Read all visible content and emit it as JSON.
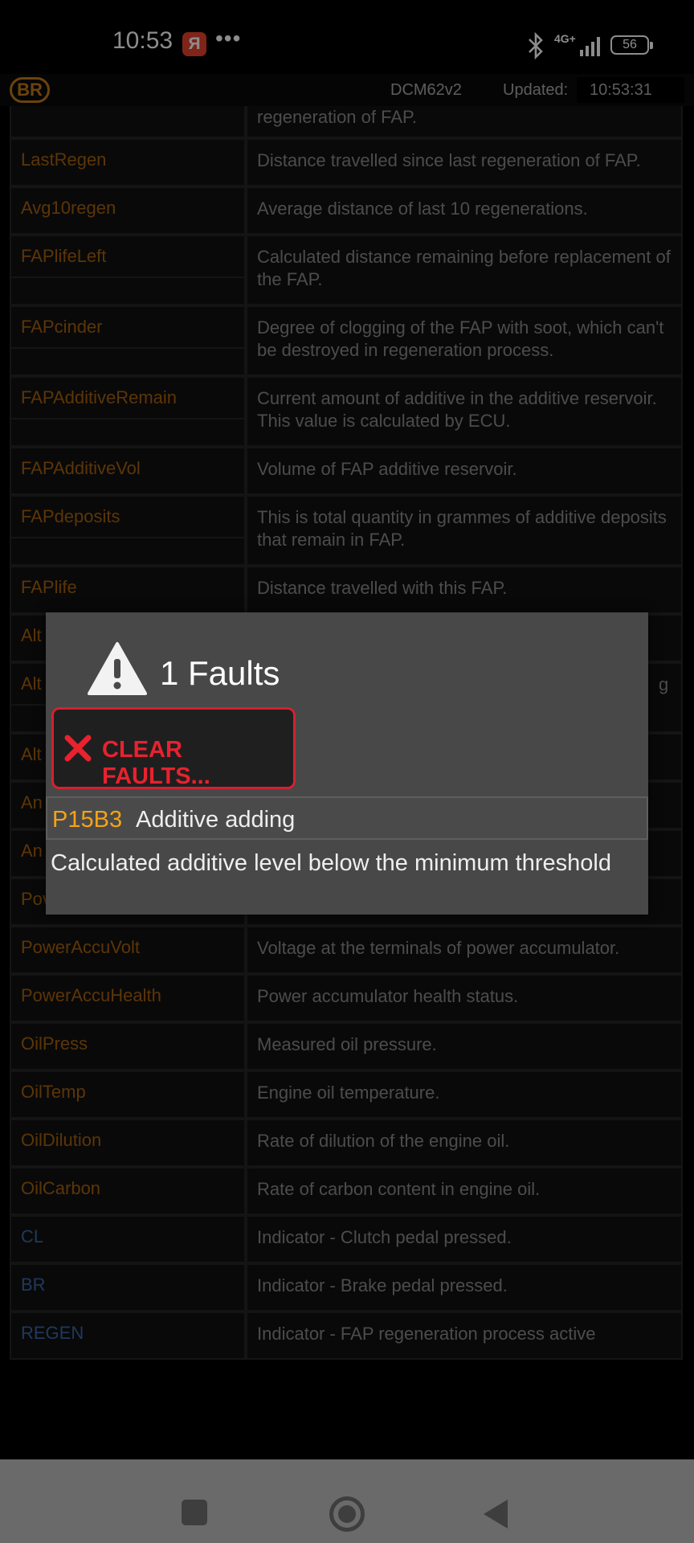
{
  "status_bar": {
    "time": "10:53",
    "app_badge": "Я",
    "more": "•••",
    "network": "4G+",
    "battery": "56"
  },
  "header": {
    "badge": "BR",
    "ecu": "DCM62v2",
    "updated_label": "Updated:",
    "updated_time": "10:53:31"
  },
  "table": {
    "rows": [
      {
        "name": "",
        "desc": "regeneration of FAP."
      },
      {
        "name": "LastRegen",
        "desc": "Distance travelled since last regeneration of FAP."
      },
      {
        "name": "Avg10regen",
        "desc": "Average distance of last 10 regenerations."
      },
      {
        "name": "FAPlifeLeft",
        "desc": "Calculated distance remaining before replacement of the FAP."
      },
      {
        "name": "FAPcinder",
        "desc": "Degree of clogging of the FAP with soot, which can't be destroyed in regeneration process."
      },
      {
        "name": "FAPAdditiveRemain",
        "desc": "Current amount of additive in the additive reservoir. This value is calculated by ECU."
      },
      {
        "name": "FAPAdditiveVol",
        "desc": "Volume of FAP additive reservoir."
      },
      {
        "name": "FAPdeposits",
        "desc": "This is total quantity in grammes of additive deposits that remain in FAP."
      },
      {
        "name": "FAPlife",
        "desc": "Distance travelled with this FAP."
      },
      {
        "name": "Alt",
        "desc": ""
      },
      {
        "name": "Alt",
        "desc": "g"
      },
      {
        "name": "Alt",
        "desc": ""
      },
      {
        "name": "An",
        "desc": ""
      },
      {
        "name": "An",
        "desc": ""
      },
      {
        "name": "Pov",
        "desc": ""
      },
      {
        "name": "PowerAccuVolt",
        "desc": "Voltage at the terminals of power accumulator."
      },
      {
        "name": "PowerAccuHealth",
        "desc": "Power accumulator health status."
      },
      {
        "name": "OilPress",
        "desc": "Measured oil pressure."
      },
      {
        "name": "OilTemp",
        "desc": "Engine oil temperature."
      },
      {
        "name": "OilDilution",
        "desc": "Rate of dilution of the engine oil."
      },
      {
        "name": "OilCarbon",
        "desc": "Rate of carbon content in engine oil."
      },
      {
        "name": "CL",
        "desc": "Indicator - Clutch pedal pressed."
      },
      {
        "name": "BR",
        "desc": "Indicator - Brake pedal pressed."
      },
      {
        "name": "REGEN",
        "desc": "Indicator - FAP regeneration process active"
      }
    ]
  },
  "dialog": {
    "title": "1 Faults",
    "clear_button": "CLEAR FAULTS...",
    "fault_code": "P15B3",
    "fault_name": "Additive adding",
    "fault_description": "Calculated additive level below the minimum threshold"
  },
  "colors": {
    "param_orange": "#a8620e",
    "param_blue": "#3d66a8",
    "fault_code": "#f5a316",
    "clear_red": "#e8222e"
  }
}
